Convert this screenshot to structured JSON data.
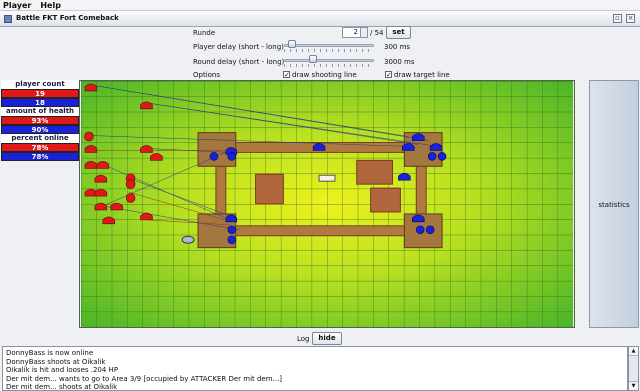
{
  "menu": {
    "items": [
      "Player",
      "Help"
    ]
  },
  "window": {
    "title": "Battle FKT Fort Comeback"
  },
  "controls": {
    "round_label": "Runde",
    "round_value": "2",
    "round_total": "/ 54",
    "set_label": "set",
    "player_delay_label": "Player delay (short - long)",
    "player_delay_value": "300 ms",
    "player_delay_level": 0.05,
    "round_delay_label": "Round delay (short - long)",
    "round_delay_value": "3000 ms",
    "round_delay_level": 0.3,
    "options_label": "Options",
    "draw_shooting_line": {
      "label": "draw shooting line",
      "checked": true
    },
    "draw_target_line": {
      "label": "draw target line",
      "checked": true
    }
  },
  "stats": [
    {
      "header": "player count",
      "bars": [
        {
          "value": "19",
          "team": "red"
        },
        {
          "value": "18",
          "team": "blue"
        }
      ]
    },
    {
      "header": "amount of health",
      "bars": [
        {
          "value": "93%",
          "team": "red"
        },
        {
          "value": "90%",
          "team": "blue"
        }
      ]
    },
    {
      "header": "percent online",
      "bars": [
        {
          "value": "78%",
          "team": "red"
        },
        {
          "value": "78%",
          "team": "blue"
        }
      ]
    }
  ],
  "colors": {
    "team_red": "#e01818",
    "team_blue": "#1a22d8",
    "grass_light": "#e8ef1e",
    "grass_dark": "#3db02a"
  },
  "statistics_button": "statistics",
  "log": {
    "label": "Log",
    "hide_label": "hide",
    "lines": [
      "DonnyBass is now online",
      "DonnyBass shoots at Oikalik",
      "Oikalik is hit and looses .204 HP",
      "Der mit dem... wants to go to Area 3/9 [occupied by ATTACKER Der mit dem...]",
      "Der mit dem... shoots at Oikalik"
    ]
  }
}
